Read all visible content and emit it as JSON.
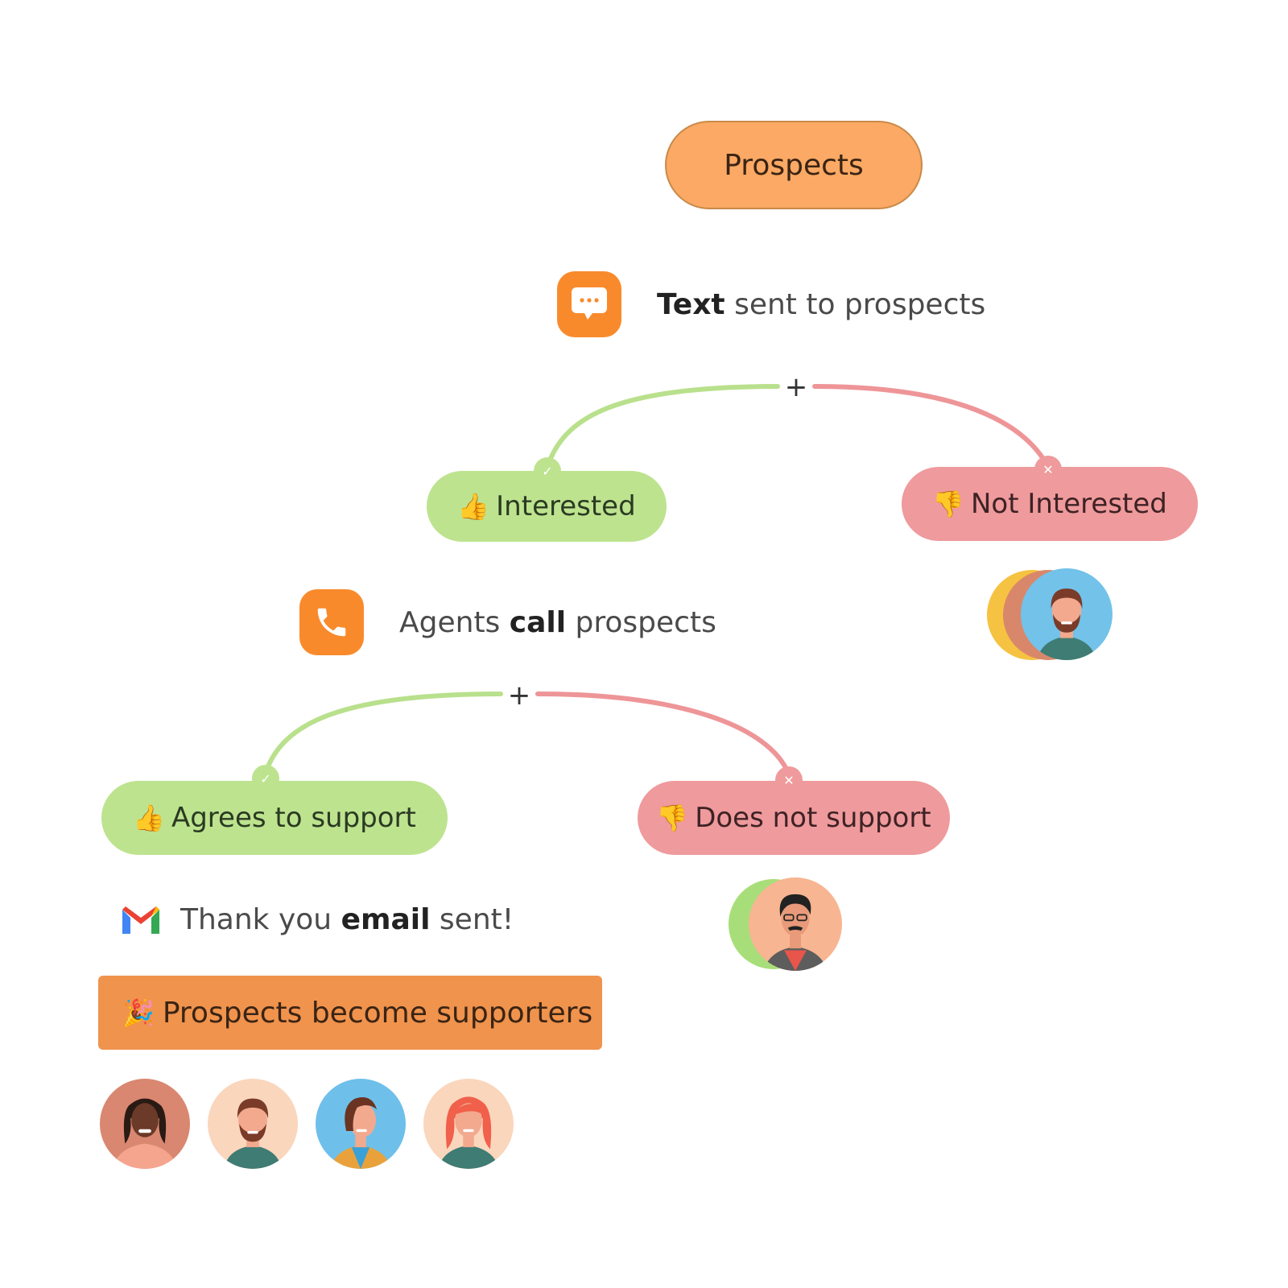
{
  "colors": {
    "root": "#fba964",
    "positive": "#bde38f",
    "negative": "#ef9a9c",
    "positive_line": "#b9e08c",
    "negative_line": "#ee9598",
    "step_icon": "#f98a2c",
    "result": "#f0934d"
  },
  "root": {
    "label": "Prospects"
  },
  "step1": {
    "icon": "chat-bubble-icon",
    "bold": "Text",
    "rest": " sent to prospects"
  },
  "branch1": {
    "plus": "+",
    "yes": {
      "emoji": "👍",
      "label": "Interested",
      "badge": "✓"
    },
    "no": {
      "emoji": "👎",
      "label": "Not Interested",
      "badge": "✕"
    }
  },
  "step2": {
    "icon": "phone-icon",
    "pre": "Agents ",
    "bold": "call",
    "rest": " prospects"
  },
  "branch2": {
    "plus": "+",
    "yes": {
      "emoji": "👍",
      "label": "Agrees to support",
      "badge": "✓"
    },
    "no": {
      "emoji": "👎",
      "label": "Does not support",
      "badge": "✕"
    }
  },
  "step3": {
    "icon": "gmail-icon",
    "pre": "Thank you ",
    "bold": "email",
    "rest": " sent!"
  },
  "result": {
    "emoji": "🎉",
    "label": "Prospects become supporters"
  },
  "avatars": {
    "not_interested_stack": [
      "yellow",
      "terracotta",
      "bearded-man-blue"
    ],
    "does_not_support_stack": [
      "green",
      "man-glasses-peach"
    ],
    "supporters": [
      "woman-dark-hair",
      "bearded-man",
      "woman-blue-bg",
      "woman-red-hair"
    ]
  }
}
